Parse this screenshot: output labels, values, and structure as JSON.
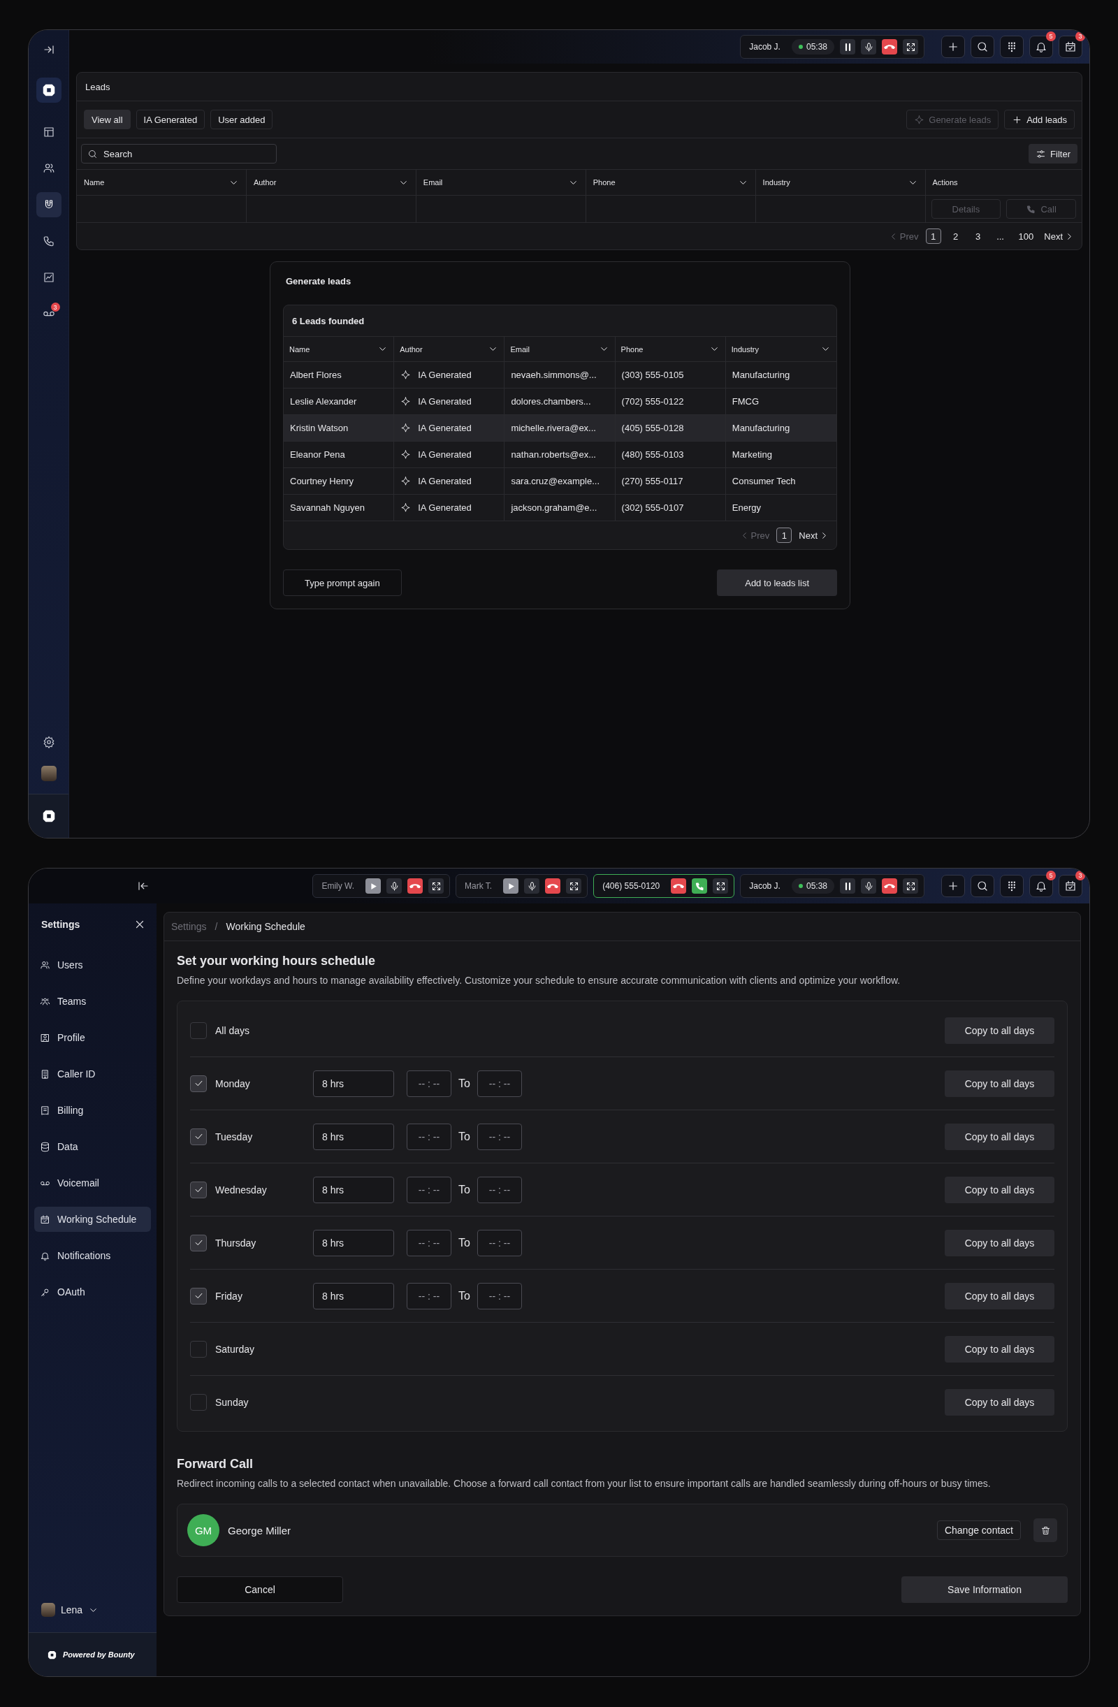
{
  "leads_screen": {
    "sidebar": {
      "items": [
        {
          "kind": "layout",
          "selected": false
        },
        {
          "kind": "users",
          "selected": false
        },
        {
          "kind": "magnet",
          "selected": true
        },
        {
          "kind": "phone",
          "selected": false
        },
        {
          "kind": "chart",
          "selected": false
        },
        {
          "kind": "voicemail",
          "selected": false,
          "badge": "3"
        }
      ]
    },
    "calls": [
      {
        "kind": "active",
        "caller": "Jacob J.",
        "timer": "05:38"
      }
    ],
    "notification_badge": "5",
    "calendar_badge": "3",
    "leads": {
      "title": "Leads",
      "tabs": [
        {
          "label": "View all",
          "selected": true
        },
        {
          "label": "IA Generated",
          "selected": false
        },
        {
          "label": "User added",
          "selected": false
        }
      ],
      "generate_button": {
        "label": "Generate leads",
        "disabled": true
      },
      "add_button": "Add leads",
      "search": {
        "placeholder": "Search"
      },
      "filter_button": "Filter",
      "columns": [
        {
          "label": "Name",
          "dropdown": true
        },
        {
          "label": "Author",
          "dropdown": true
        },
        {
          "label": "Email",
          "dropdown": true
        },
        {
          "label": "Phone",
          "dropdown": true
        },
        {
          "label": "Industry",
          "dropdown": true
        },
        {
          "label": "Actions",
          "dropdown": false
        }
      ],
      "row_actions": [
        {
          "label": "Details",
          "kind": "details",
          "disabled": true
        },
        {
          "label": "Call",
          "kind": "call",
          "disabled": true
        }
      ],
      "pagination": {
        "prev": {
          "label": "Prev",
          "disabled": true
        },
        "pages": [
          {
            "label": "1",
            "selected": true
          },
          {
            "label": "2",
            "selected": false
          },
          {
            "label": "3",
            "selected": false
          },
          {
            "label": "...",
            "selected": false
          },
          {
            "label": "100",
            "selected": false
          }
        ],
        "next": {
          "label": "Next",
          "disabled": false
        }
      }
    },
    "generate_modal": {
      "title": "Generate leads",
      "count_title": "6 Leads founded",
      "columns": [
        "Name",
        "Author",
        "Email",
        "Phone",
        "Industry"
      ],
      "rows": [
        {
          "name": "Albert Flores",
          "author": "IA Generated",
          "email": "nevaeh.simmons@...",
          "phone": "(303) 555-0105",
          "industry": "Manufacturing",
          "highlighted": false
        },
        {
          "name": "Leslie Alexander",
          "author": "IA Generated",
          "email": "dolores.chambers...",
          "phone": "(702) 555-0122",
          "industry": "FMCG",
          "highlighted": false
        },
        {
          "name": "Kristin Watson",
          "author": "IA Generated",
          "email": "michelle.rivera@ex...",
          "phone": "(405) 555-0128",
          "industry": "Manufacturing",
          "highlighted": true
        },
        {
          "name": "Eleanor Pena",
          "author": "IA Generated",
          "email": "nathan.roberts@ex...",
          "phone": "(480) 555-0103",
          "industry": "Marketing",
          "highlighted": false
        },
        {
          "name": "Courtney Henry",
          "author": "IA Generated",
          "email": "sara.cruz@example...",
          "phone": "(270) 555-0117",
          "industry": "Consumer Tech",
          "highlighted": false
        },
        {
          "name": "Savannah Nguyen",
          "author": "IA Generated",
          "email": "jackson.graham@e...",
          "phone": "(302) 555-0107",
          "industry": "Energy",
          "highlighted": false
        }
      ],
      "pagination": {
        "prev": {
          "label": "Prev",
          "disabled": true
        },
        "pages": [
          {
            "label": "1",
            "selected": true
          }
        ],
        "next": {
          "label": "Next",
          "disabled": false
        }
      },
      "secondary_button": "Type prompt again",
      "primary_button": "Add to leads list"
    }
  },
  "settings_screen": {
    "calls": [
      {
        "kind": "held",
        "caller": "Emily W."
      },
      {
        "kind": "held",
        "caller": "Mark T."
      },
      {
        "kind": "incoming",
        "caller": "(406) 555-0120"
      },
      {
        "kind": "active",
        "caller": "Jacob J.",
        "timer": "05:38"
      }
    ],
    "notification_badge": "5",
    "calendar_badge": "3",
    "sidebar": {
      "title": "Settings",
      "items": [
        {
          "label": "Users",
          "kind": "users",
          "selected": false
        },
        {
          "label": "Teams",
          "kind": "teams",
          "selected": false
        },
        {
          "label": "Profile",
          "kind": "profile",
          "selected": false
        },
        {
          "label": "Caller ID",
          "kind": "building",
          "selected": false
        },
        {
          "label": "Billing",
          "kind": "billing",
          "selected": false
        },
        {
          "label": "Data",
          "kind": "data",
          "selected": false
        },
        {
          "label": "Voicemail",
          "kind": "voicemail",
          "selected": false
        },
        {
          "label": "Working Schedule",
          "kind": "calendar",
          "selected": true
        },
        {
          "label": "Notifications",
          "kind": "bell",
          "selected": false
        },
        {
          "label": "OAuth",
          "kind": "key",
          "selected": false
        }
      ],
      "user": "Lena",
      "footer": "Powered by Bounty"
    },
    "breadcrumb": {
      "items": [
        "Settings",
        "Working Schedule"
      ],
      "separator": "/"
    },
    "schedule": {
      "title": "Set your working hours schedule",
      "description": "Define your workdays and hours to manage availability effectively. Customize your schedule to ensure accurate communication with clients and optimize your workflow.",
      "days": [
        {
          "label": "All days",
          "checked": false,
          "copy_button": "Copy to all days"
        },
        {
          "label": "Monday",
          "checked": true,
          "hours": "8 hrs",
          "start_placeholder": "-- : --",
          "to": "To",
          "end_placeholder": "-- : --",
          "copy_button": "Copy to all days"
        },
        {
          "label": "Tuesday",
          "checked": true,
          "hours": "8 hrs",
          "start_placeholder": "-- : --",
          "to": "To",
          "end_placeholder": "-- : --",
          "copy_button": "Copy to all days"
        },
        {
          "label": "Wednesday",
          "checked": true,
          "hours": "8 hrs",
          "start_placeholder": "-- : --",
          "to": "To",
          "end_placeholder": "-- : --",
          "copy_button": "Copy to all days"
        },
        {
          "label": "Thursday",
          "checked": true,
          "hours": "8 hrs",
          "start_placeholder": "-- : --",
          "to": "To",
          "end_placeholder": "-- : --",
          "copy_button": "Copy to all days"
        },
        {
          "label": "Friday",
          "checked": true,
          "hours": "8 hrs",
          "start_placeholder": "-- : --",
          "to": "To",
          "end_placeholder": "-- : --",
          "copy_button": "Copy to all days"
        },
        {
          "label": "Saturday",
          "checked": false,
          "copy_button": "Copy to all days"
        },
        {
          "label": "Sunday",
          "checked": false,
          "copy_button": "Copy to all days"
        }
      ]
    },
    "forward_call": {
      "title": "Forward Call",
      "description": "Redirect incoming calls to a selected contact when unavailable. Choose a forward call contact from your list to ensure important calls are handled seamlessly during off-hours or busy times.",
      "contact": {
        "initials": "GM",
        "name": "George Miller"
      },
      "change_button": "Change contact"
    },
    "cancel_button": "Cancel",
    "save_button": "Save Information"
  }
}
